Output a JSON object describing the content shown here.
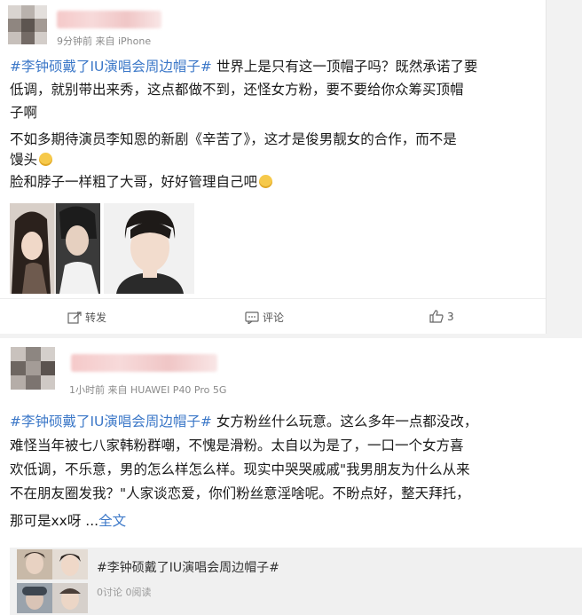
{
  "post1": {
    "meta": "9分钟前  来自 iPhone",
    "hashtag": "#李钟硕戴了IU演唱会周边帽子#",
    "line1_rest": " 世界上是只有这一顶帽子吗？既然承诺了要",
    "line2": "低调，就别带出来秀，这点都做不到，还怪女方粉，要不要给你众筹买顶帽",
    "line3": "子啊",
    "line4": "不如多期待演员李知恩的新剧《辛苦了》，这才是俊男靓女的合作，而不是",
    "line5": "馒头",
    "line6": "脸和脖子一样粗了大哥，好好管理自己吧",
    "actions": {
      "repost": "转发",
      "comment": "评论",
      "like_count": "3"
    }
  },
  "post2": {
    "meta": "1小时前  来自 HUAWEI P40 Pro 5G",
    "hashtag": "#李钟硕戴了IU演唱会周边帽子#",
    "line1_rest": " 女方粉丝什么玩意。这么多年一点都没改，",
    "line2": "难怪当年被七八家韩粉群嘲，不愧是滑粉。太自以为是了，一口一个女方喜",
    "line3": "欢低调，不乐意，男的怎么样怎么样。现实中哭哭戚戚\"我男朋友为什么从来",
    "line4": "不在朋友圈发我？\"人家谈恋爱，你们粉丝意淫啥呢。不盼点好，整天拜托，",
    "line5": "那可是xx呀 ...",
    "more": "全文",
    "quote": {
      "title": "#李钟硕戴了IU演唱会周边帽子#",
      "stats": "0讨论  0阅读"
    }
  },
  "colors": {
    "hashtag": "#3c78c8",
    "meta": "#8a8a8a"
  }
}
